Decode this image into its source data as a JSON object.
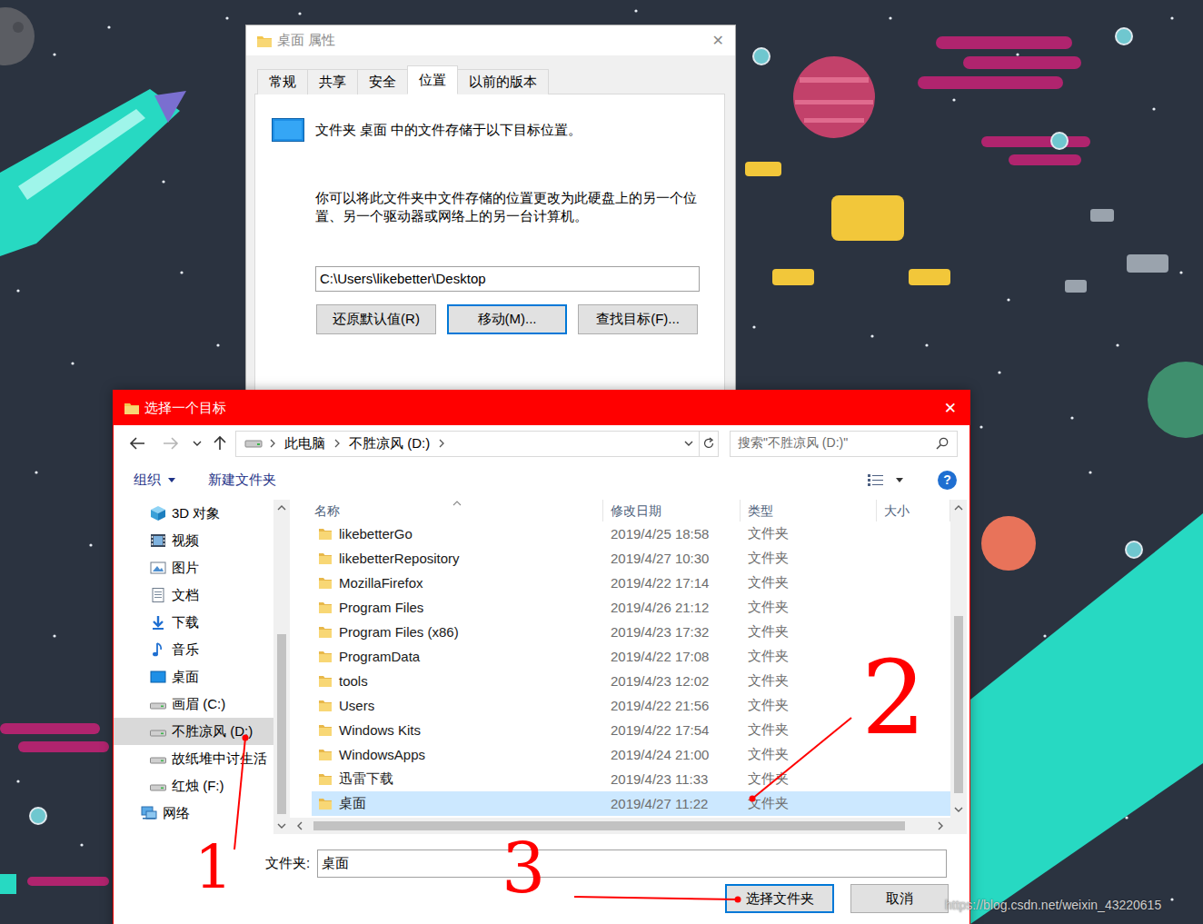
{
  "desktop": {
    "watermark": "https://blog.csdn.net/weixin_43220615"
  },
  "properties_window": {
    "title": "桌面 属性",
    "close": "✕",
    "tabs": [
      {
        "label": "常规",
        "selected": false
      },
      {
        "label": "共享",
        "selected": false
      },
      {
        "label": "安全",
        "selected": false
      },
      {
        "label": "位置",
        "selected": true
      },
      {
        "label": "以前的版本",
        "selected": false
      }
    ],
    "heading": "文件夹 桌面 中的文件存储于以下目标位置。",
    "description": "你可以将此文件夹中文件存储的位置更改为此硬盘上的另一个位置、另一个驱动器或网络上的另一台计算机。",
    "path": "C:\\Users\\likebetter\\Desktop",
    "buttons": [
      {
        "label": "还原默认值(R)",
        "focused": false
      },
      {
        "label": "移动(M)...",
        "focused": true
      },
      {
        "label": "查找目标(F)...",
        "focused": false
      }
    ]
  },
  "dialog": {
    "title": "选择一个目标",
    "close": "✕",
    "breadcrumb": [
      "此电脑",
      "不胜凉风 (D:)"
    ],
    "search": {
      "placeholder": "搜索\"不胜凉风 (D:)\""
    },
    "toolbar": {
      "organize": "组织",
      "new_folder": "新建文件夹",
      "help": "?"
    },
    "sidebar": {
      "items": [
        {
          "label": "3D 对象",
          "kind": "cube",
          "selected": false
        },
        {
          "label": "视频",
          "kind": "video",
          "selected": false
        },
        {
          "label": "图片",
          "kind": "pictures",
          "selected": false
        },
        {
          "label": "文档",
          "kind": "documents",
          "selected": false
        },
        {
          "label": "下载",
          "kind": "downloads",
          "selected": false
        },
        {
          "label": "音乐",
          "kind": "music",
          "selected": false
        },
        {
          "label": "桌面",
          "kind": "desktop",
          "selected": false
        },
        {
          "label": "画眉 (C:)",
          "kind": "drive",
          "selected": false
        },
        {
          "label": "不胜凉风 (D:)",
          "kind": "drive",
          "selected": true
        },
        {
          "label": "故纸堆中讨生活",
          "kind": "drive",
          "selected": false
        },
        {
          "label": "红烛 (F:)",
          "kind": "drive",
          "selected": false
        },
        {
          "label": "网络",
          "kind": "network",
          "selected": false
        }
      ]
    },
    "table": {
      "columns": [
        "名称",
        "修改日期",
        "类型",
        "大小"
      ],
      "rows": [
        {
          "name": "likebetterGo",
          "modified": "2019/4/25 18:58",
          "type": "文件夹",
          "selected": false
        },
        {
          "name": "likebetterRepository",
          "modified": "2019/4/27 10:30",
          "type": "文件夹",
          "selected": false
        },
        {
          "name": "MozillaFirefox",
          "modified": "2019/4/22 17:14",
          "type": "文件夹",
          "selected": false
        },
        {
          "name": "Program Files",
          "modified": "2019/4/26 21:12",
          "type": "文件夹",
          "selected": false
        },
        {
          "name": "Program Files (x86)",
          "modified": "2019/4/23 17:32",
          "type": "文件夹",
          "selected": false
        },
        {
          "name": "ProgramData",
          "modified": "2019/4/22 17:08",
          "type": "文件夹",
          "selected": false
        },
        {
          "name": "tools",
          "modified": "2019/4/23 12:02",
          "type": "文件夹",
          "selected": false
        },
        {
          "name": "Users",
          "modified": "2019/4/22 21:56",
          "type": "文件夹",
          "selected": false
        },
        {
          "name": "Windows Kits",
          "modified": "2019/4/22 17:54",
          "type": "文件夹",
          "selected": false
        },
        {
          "name": "WindowsApps",
          "modified": "2019/4/24 21:00",
          "type": "文件夹",
          "selected": false
        },
        {
          "name": "迅雷下载",
          "modified": "2019/4/23 11:33",
          "type": "文件夹",
          "selected": false
        },
        {
          "name": "桌面",
          "modified": "2019/4/27 11:22",
          "type": "文件夹",
          "selected": true
        }
      ]
    },
    "folder_field": {
      "label": "文件夹:",
      "value": "桌面"
    },
    "buttons": [
      {
        "label": "选择文件夹",
        "default": true
      },
      {
        "label": "取消",
        "default": false
      }
    ]
  },
  "annotations": [
    {
      "label": "1"
    },
    {
      "label": "2"
    },
    {
      "label": "3"
    }
  ]
}
